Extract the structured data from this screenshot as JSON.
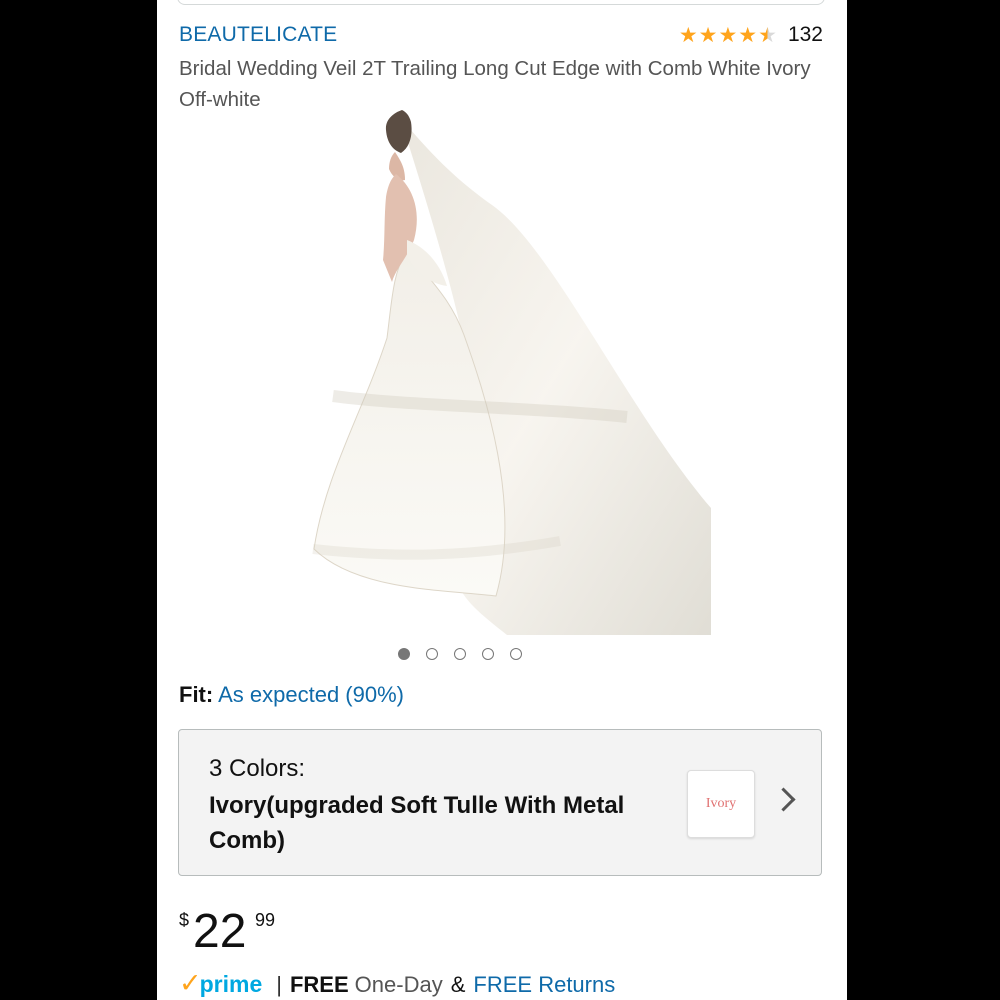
{
  "product": {
    "brand": "BEAUTELICATE",
    "rating_count": "132",
    "rating_value": 4.5,
    "title": "Bridal Wedding Veil 2T Trailing Long Cut Edge with Comb White Ivory Off-white"
  },
  "carousel": {
    "total": 5,
    "active_index": 0
  },
  "fit": {
    "label": "Fit:",
    "value": "As expected (90%)"
  },
  "color_selector": {
    "count_label": "3 Colors:",
    "selected": "Ivory(upgraded Soft Tulle With Metal Comb)",
    "swatch_label": "Ivory"
  },
  "price": {
    "currency": "$",
    "whole": "22",
    "fraction": "99"
  },
  "delivery": {
    "prime_label": "prime",
    "separator": "|",
    "free_label": "FREE",
    "speed": "One-Day",
    "ampersand": "&",
    "returns": "FREE Returns"
  },
  "colors": {
    "link": "#0f6aa9",
    "star": "#ffa41c",
    "prime": "#00a8e1"
  }
}
